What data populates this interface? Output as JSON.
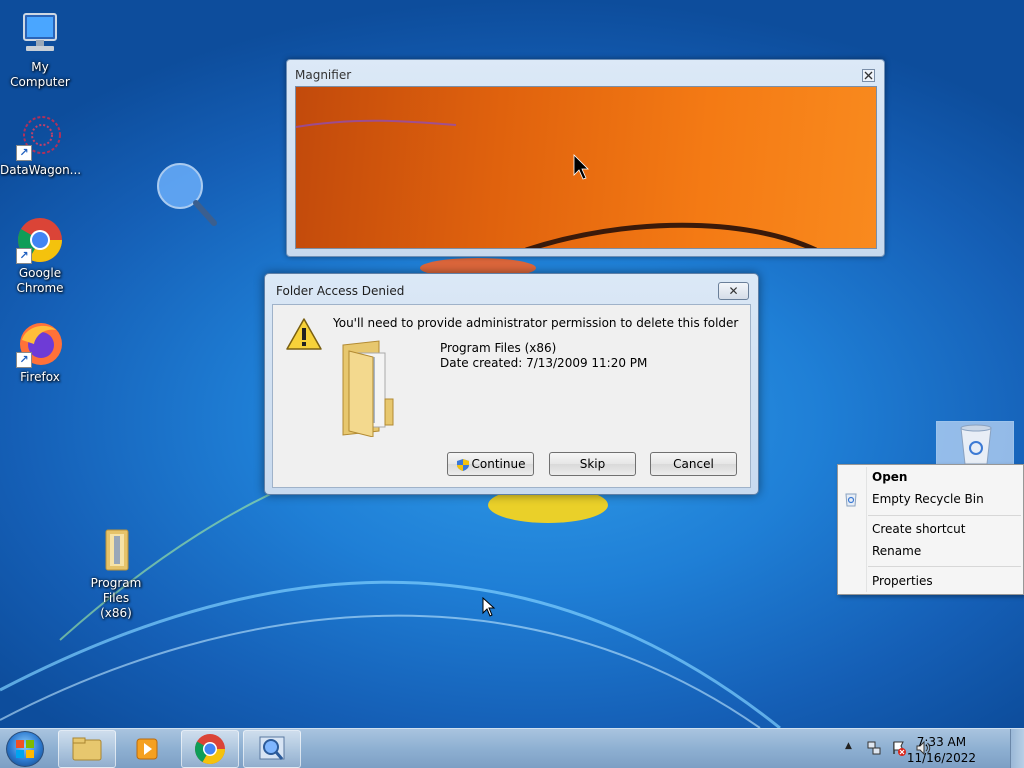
{
  "desktop_icons": {
    "my_computer": "My Computer",
    "datawagon": "DataWagon...",
    "chrome_line1": "Google",
    "chrome_line2": "Chrome",
    "firefox": "Firefox",
    "program_files_line1": "Program Files",
    "program_files_line2": "(x86)"
  },
  "magnifier": {
    "title": "Magnifier",
    "close_label": "☒"
  },
  "dialog": {
    "title": "Folder Access Denied",
    "close_label": "✕",
    "message": "You'll need to provide administrator permission to delete this folder",
    "folder_name": "Program Files (x86)",
    "date_created": "Date created: 7/13/2009 11:20 PM",
    "buttons": {
      "continue": "Continue",
      "skip": "Skip",
      "cancel": "Cancel"
    }
  },
  "context_menu": {
    "items": [
      "Open",
      "Empty Recycle Bin",
      "Create shortcut",
      "Rename",
      "Properties"
    ]
  },
  "taskbar": {
    "time": "7:33 AM",
    "date": "11/16/2022",
    "tray_expand": "▲"
  },
  "colors": {
    "desktop": "#1f7fd6",
    "magnifier_view": "#f47a14",
    "taskbar": "#8eb0d2"
  }
}
